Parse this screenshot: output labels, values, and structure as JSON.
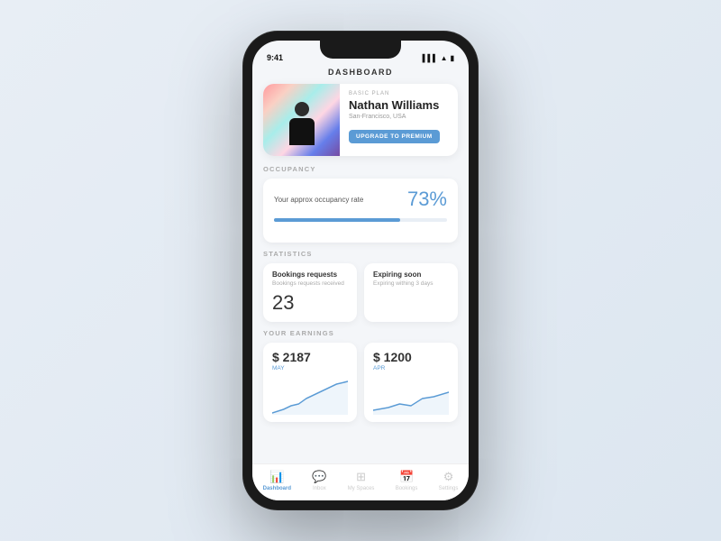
{
  "phone": {
    "statusBar": {
      "time": "9:41",
      "icons": [
        "signal",
        "wifi",
        "battery"
      ]
    },
    "header": {
      "title": "DASHBOARD"
    },
    "profile": {
      "badgeLabel": "BASIC PLAN",
      "name": "Nathan Williams",
      "location": "San-Francisco, USA",
      "upgradeButton": "UPGRADE TO PREMIUM"
    },
    "occupancy": {
      "sectionTitle": "OCCUPANCY",
      "label": "Your approx occupancy rate",
      "percentage": "73%",
      "fillPercent": 73
    },
    "statistics": {
      "sectionTitle": "STATISTICS",
      "bookings": {
        "label": "Bookings requests",
        "sublabel": "Bookings requests received",
        "value": "23"
      },
      "expiring": {
        "label": "Expiring soon",
        "sublabel": "Expiring withing 3 days",
        "value": ""
      }
    },
    "earnings": {
      "sectionTitle": "YOUR EARNINGS",
      "card1": {
        "amount": "$ 2187",
        "period": "MAY"
      },
      "card2": {
        "amount": "$ 1200",
        "period": "APR"
      }
    },
    "nav": {
      "items": [
        {
          "id": "dashboard",
          "label": "Dashboard",
          "active": true
        },
        {
          "id": "inbox",
          "label": "Inbox",
          "active": false
        },
        {
          "id": "my-spaces",
          "label": "My Spaces",
          "active": false
        },
        {
          "id": "bookings",
          "label": "Bookings",
          "active": false
        },
        {
          "id": "settings",
          "label": "Settings",
          "active": false
        }
      ]
    }
  }
}
